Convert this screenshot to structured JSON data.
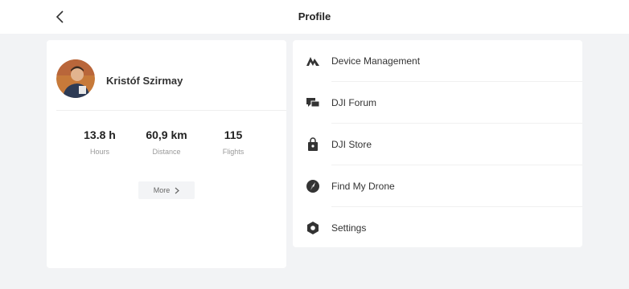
{
  "header": {
    "title": "Profile",
    "back_icon": "chevron-left-icon"
  },
  "profile": {
    "name": "Kristóf Szirmay",
    "stats": [
      {
        "value": "13.8 h",
        "label": "Hours"
      },
      {
        "value": "60,9 km",
        "label": "Distance"
      },
      {
        "value": "115",
        "label": "Flights"
      }
    ],
    "more_label": "More"
  },
  "menu": {
    "items": [
      {
        "label": "Device Management",
        "icon": "device-management-icon"
      },
      {
        "label": "DJI Forum",
        "icon": "forum-icon"
      },
      {
        "label": "DJI Store",
        "icon": "store-bag-icon"
      },
      {
        "label": "Find My Drone",
        "icon": "find-drone-icon"
      },
      {
        "label": "Settings",
        "icon": "settings-hexagon-icon"
      }
    ]
  }
}
